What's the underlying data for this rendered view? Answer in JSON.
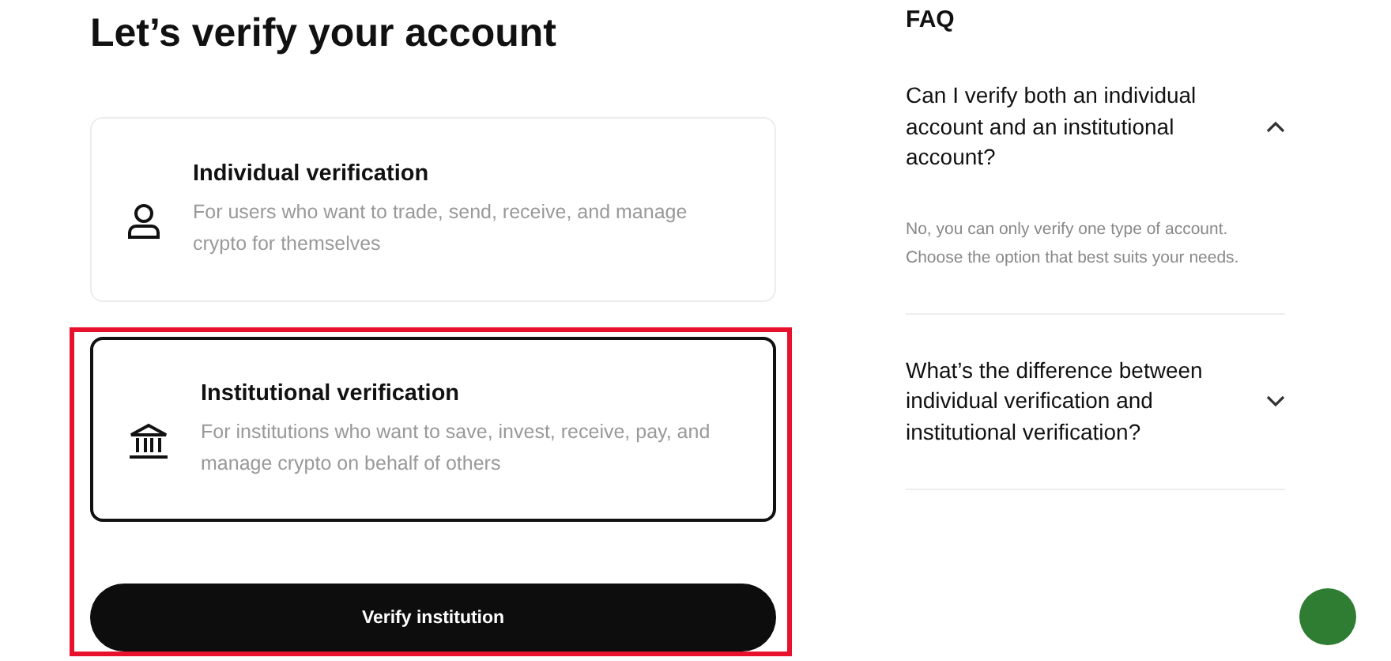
{
  "title": "Let’s verify your account",
  "options": [
    {
      "kind": "person",
      "title": "Individual verification",
      "description": "For users who want to trade, send, receive, and manage crypto for themselves",
      "selected": false
    },
    {
      "kind": "bank",
      "title": "Institutional verification",
      "description": "For institutions who want to save, invest, receive, pay, and manage crypto on behalf of others",
      "selected": true
    }
  ],
  "button": "Verify institution",
  "faq": {
    "heading": "FAQ",
    "items": [
      {
        "question": "Can I verify both an individual account and an institutional account?",
        "answer": "No, you can only verify one type of account. Choose the option that best suits your needs.",
        "expanded": true
      },
      {
        "question": "What’s the difference between individual verification and institutional verification?",
        "expanded": false
      }
    ]
  }
}
